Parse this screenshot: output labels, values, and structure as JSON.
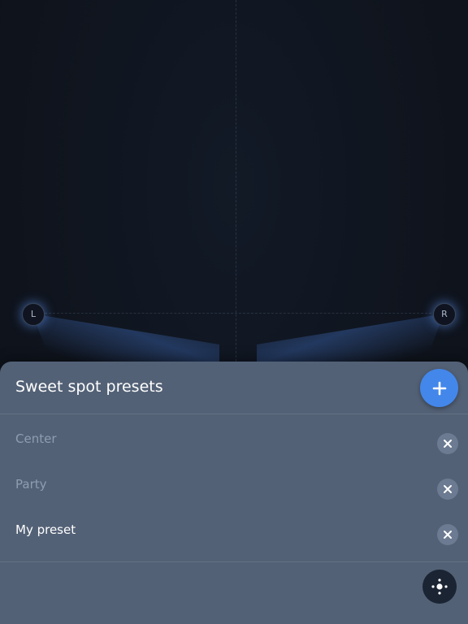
{
  "room": {
    "left_speaker_label": "L",
    "right_speaker_label": "R"
  },
  "sheet": {
    "title": "Sweet spot presets",
    "add_icon": "plus-icon",
    "presets": [
      {
        "label": "Center",
        "selected": false
      },
      {
        "label": "Party",
        "selected": false
      },
      {
        "label": "My preset",
        "selected": true
      }
    ],
    "delete_icon": "close-icon",
    "locate_icon": "locate-icon"
  },
  "colors": {
    "accent": "#4387ea",
    "sheet_background": "#536176",
    "canvas_background": "#10151f"
  }
}
